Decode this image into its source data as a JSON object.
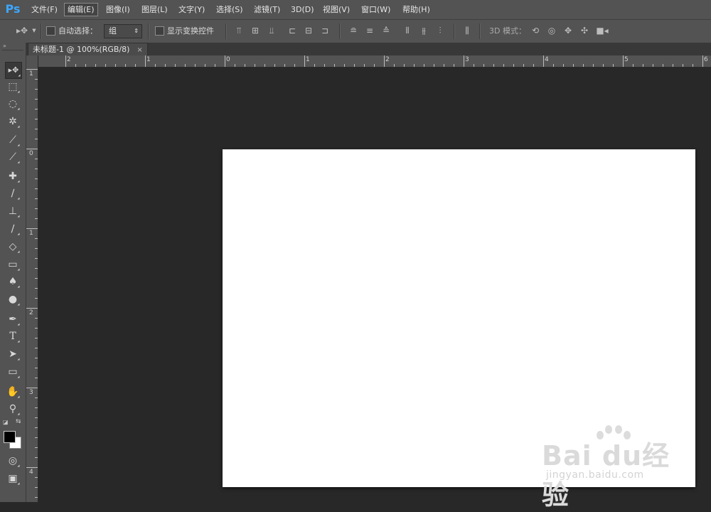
{
  "app": {
    "logo": "Ps"
  },
  "menu": [
    {
      "label": "文件(F)"
    },
    {
      "label": "编辑(E)",
      "active": true
    },
    {
      "label": "图像(I)"
    },
    {
      "label": "图层(L)"
    },
    {
      "label": "文字(Y)"
    },
    {
      "label": "选择(S)"
    },
    {
      "label": "滤镜(T)"
    },
    {
      "label": "3D(D)"
    },
    {
      "label": "视图(V)"
    },
    {
      "label": "窗口(W)"
    },
    {
      "label": "帮助(H)"
    }
  ],
  "options": {
    "auto_select_label": "自动选择：",
    "auto_select_value": "组",
    "show_transform_label": "显示变换控件",
    "mode_3d_label": "3D 模式："
  },
  "document": {
    "tab_title": "未标题-1 @ 100%(RGB/8)",
    "close_glyph": "×"
  },
  "rulers": {
    "top_labels": [
      "2",
      "1",
      "0",
      "1",
      "2",
      "3",
      "4",
      "5",
      "6"
    ],
    "left_labels": [
      "1",
      "0",
      "1",
      "2",
      "3",
      "4"
    ]
  },
  "watermark": {
    "brand": "Bai du经验",
    "url": "jingyan.baidu.com"
  },
  "icons": {
    "move": "▸✥",
    "marquee": "⬚",
    "lasso": "◌",
    "magic_wand": "✲",
    "crop": "⟋",
    "eyedropper": "⟋",
    "healing": "✚",
    "brush": "∕",
    "stamp": "⊥",
    "history_brush": "∕",
    "eraser": "◇",
    "gradient": "▭",
    "blur": "♠",
    "dodge": "●",
    "pen": "✒",
    "type": "T",
    "path_select": "➤",
    "shape": "▭",
    "hand": "✋",
    "zoom": "⚲",
    "quickmask": "◎",
    "screen_mode": "▣"
  }
}
